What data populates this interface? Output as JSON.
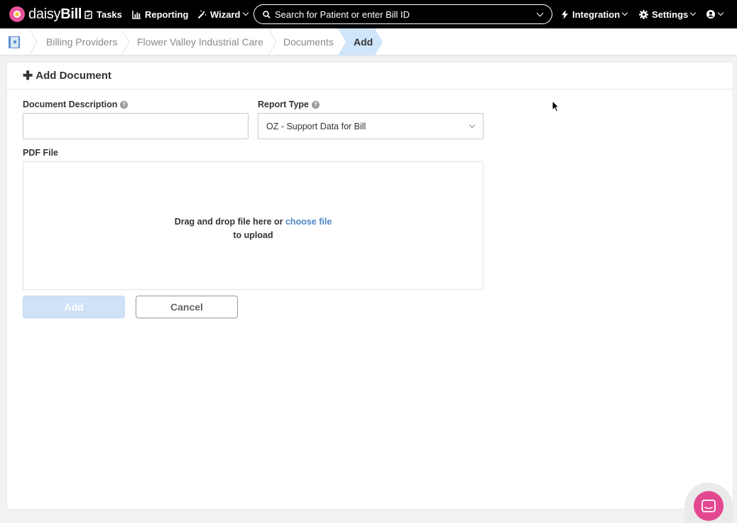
{
  "brand": {
    "name_prefix": "daisy",
    "name_suffix": "Bill"
  },
  "nav": {
    "tasks_label": "Tasks",
    "reporting_label": "Reporting",
    "wizard_label": "Wizard",
    "integration_label": "Integration",
    "settings_label": "Settings"
  },
  "search": {
    "placeholder": "Search for Patient or enter Bill ID"
  },
  "breadcrumb": {
    "items": [
      {
        "label": "Billing Providers"
      },
      {
        "label": "Flower Valley Industrial Care"
      },
      {
        "label": "Documents"
      }
    ],
    "active": "Add"
  },
  "form": {
    "title": "Add Document",
    "description_label": "Document Description",
    "description_value": "",
    "report_type_label": "Report Type",
    "report_type_value": "OZ - Support Data for Bill",
    "pdf_label": "PDF File",
    "dropzone_text_before": "Drag and drop file here or ",
    "dropzone_link": "choose file",
    "dropzone_text_after": "to upload",
    "add_button": "Add",
    "cancel_button": "Cancel"
  },
  "colors": {
    "nav_bg": "#000000",
    "brand_pink": "#e2478f",
    "link_blue": "#4a86c5",
    "active_crumb": "#cfe5f9",
    "add_button_disabled": "#cfe2f8"
  },
  "icons": [
    "logo-icon",
    "clipboard-icon",
    "chart-icon",
    "wand-icon",
    "search-icon",
    "bolt-icon",
    "gear-icon",
    "user-icon",
    "book-icon",
    "help-icon",
    "chat-icon"
  ]
}
